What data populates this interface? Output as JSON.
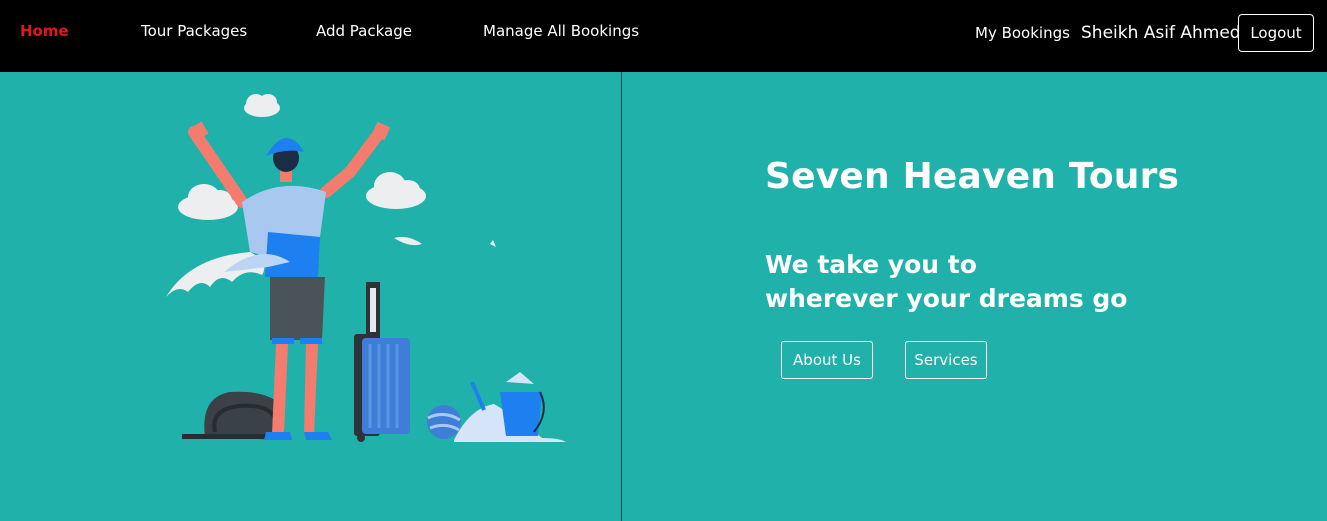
{
  "navbar": {
    "links": {
      "home": "Home",
      "tour_packages": "Tour Packages",
      "add_package": "Add Package",
      "manage_bookings": "Manage All Bookings",
      "my_bookings": "My Bookings"
    },
    "user_name": "Sheikh Asif Ahmed",
    "logout_label": "Logout",
    "active_color": "#e6141b"
  },
  "hero": {
    "title": "Seven Heaven Tours",
    "subtitle_line1": "We take you to",
    "subtitle_line2": "wherever your dreams go",
    "about_label": "About Us",
    "services_label": "Services",
    "background_color": "#20b2aa"
  },
  "illustration": {
    "icons": [
      "traveler-figure",
      "suitcase",
      "backpack",
      "beach-ball",
      "sand-bucket",
      "cloud"
    ]
  }
}
